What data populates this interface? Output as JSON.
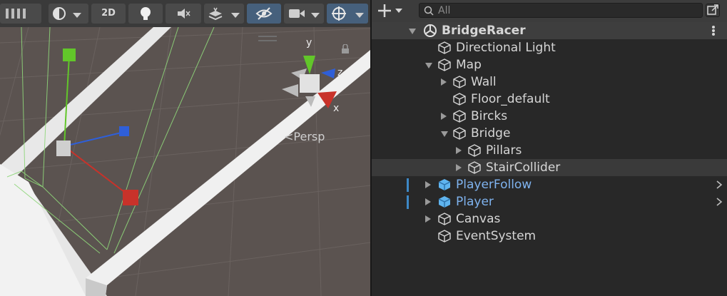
{
  "scene_view": {
    "toolbar": {
      "mode_2d_label": "2D"
    },
    "gizmo": {
      "axis_x": "x",
      "axis_y": "y",
      "axis_z": "z",
      "projection_label": "Persp"
    }
  },
  "hierarchy": {
    "search": {
      "placeholder": "All"
    },
    "scene_name": "BridgeRacer",
    "items": [
      {
        "label": "Directional Light"
      },
      {
        "label": "Map"
      },
      {
        "label": "Wall"
      },
      {
        "label": "Floor_default"
      },
      {
        "label": "Bircks"
      },
      {
        "label": "Bridge"
      },
      {
        "label": "Pillars"
      },
      {
        "label": "StairCollider"
      },
      {
        "label": "PlayerFollow"
      },
      {
        "label": "Player"
      },
      {
        "label": "Canvas"
      },
      {
        "label": "EventSystem"
      }
    ]
  },
  "colors": {
    "prefab_text": "#7fb3ef",
    "active_button": "#46607c",
    "gizmo_x": "#c8322a",
    "gizmo_y": "#62c62a",
    "gizmo_z": "#2f5fd8"
  }
}
